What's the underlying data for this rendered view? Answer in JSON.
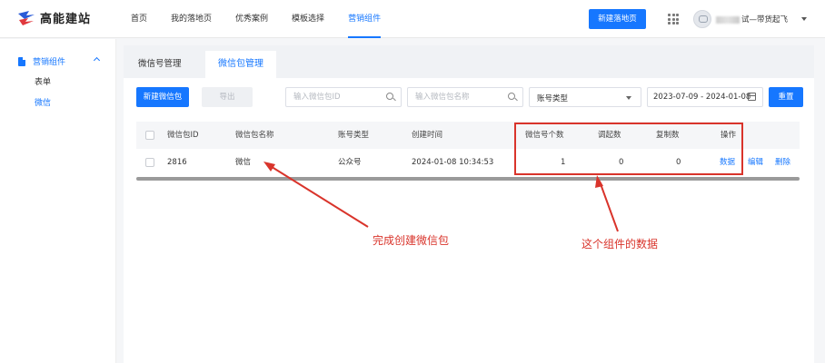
{
  "brand": {
    "name": "高能建站"
  },
  "nav": {
    "items": [
      "首页",
      "我的落地页",
      "优秀案例",
      "模板选择",
      "营销组件"
    ],
    "active_index": 4
  },
  "header": {
    "new_page_button": "新建落地页",
    "user_name": "试—带货起飞"
  },
  "sidebar": {
    "group_label": "营销组件",
    "items": [
      "表单",
      "微信"
    ],
    "active_index": 1
  },
  "tabs": {
    "items": [
      "微信号管理",
      "微信包管理"
    ],
    "active_index": 1
  },
  "toolbar": {
    "new_button": "新建微信包",
    "export_button": "导出",
    "id_placeholder": "输入微信包ID",
    "name_placeholder": "输入微信包名称",
    "account_type_label": "账号类型",
    "date_range": "2023-07-09 - 2024-01-08",
    "reset_button": "重置"
  },
  "table": {
    "headers": [
      "微信包ID",
      "微信包名称",
      "账号类型",
      "创建时间",
      "微信号个数",
      "调起数",
      "复制数",
      "操作"
    ],
    "rows": [
      {
        "id": "2816",
        "name": "微信",
        "type": "公众号",
        "created": "2024-01-08 10:34:53",
        "count": "1",
        "invoked": "0",
        "copied": "0",
        "actions": [
          "数据",
          "编辑",
          "删除"
        ]
      }
    ]
  },
  "annotations": {
    "left": "完成创建微信包",
    "right": "这个组件的数据"
  },
  "colors": {
    "primary": "#1677ff",
    "annotation": "#d9342b"
  }
}
